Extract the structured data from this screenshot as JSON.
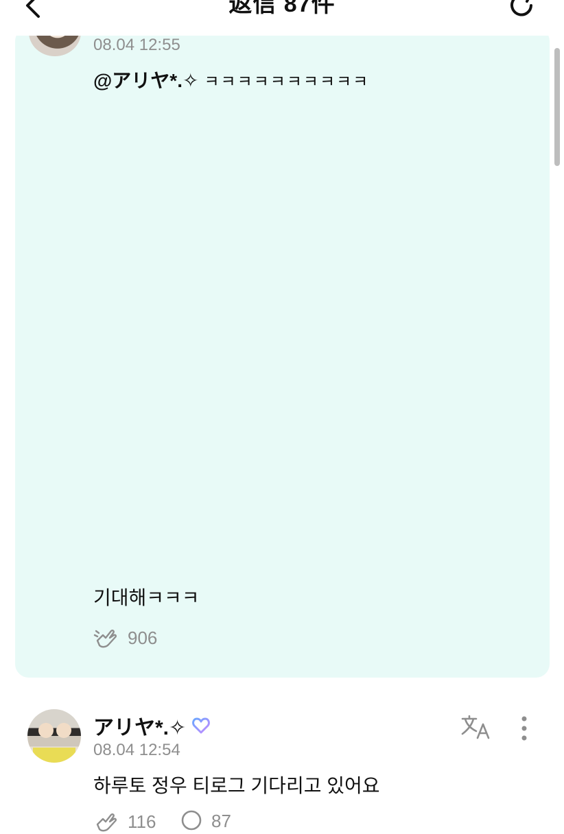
{
  "header": {
    "title": "返信 87件"
  },
  "highlighted_reply": {
    "timestamp": "08.04 12:55",
    "mention": "@アリヤ*.✧",
    "mention_text": "ㅋㅋㅋㅋㅋㅋㅋㅋㅋㅋ",
    "body": "기대해ㅋㅋㅋ",
    "like_count": "906"
  },
  "comment": {
    "username": "アリヤ*.✧",
    "timestamp": "08.04 12:54",
    "body": "하루토 정우 티로그 기다리고 있어요",
    "like_count": "116",
    "reply_count": "87"
  },
  "colors": {
    "card_background": "#e8faf7",
    "badge_gradient_start": "#6aa6ff",
    "badge_gradient_end": "#c48bff",
    "muted_text": "#8e8e8e"
  },
  "icons": {
    "back": "chevron-left-icon",
    "refresh": "refresh-icon",
    "like": "cheer-hand-icon",
    "reply": "speech-bubble-icon",
    "translate": "translate-icon",
    "more": "kebab-menu-icon",
    "badge": "heart-badge-icon"
  }
}
